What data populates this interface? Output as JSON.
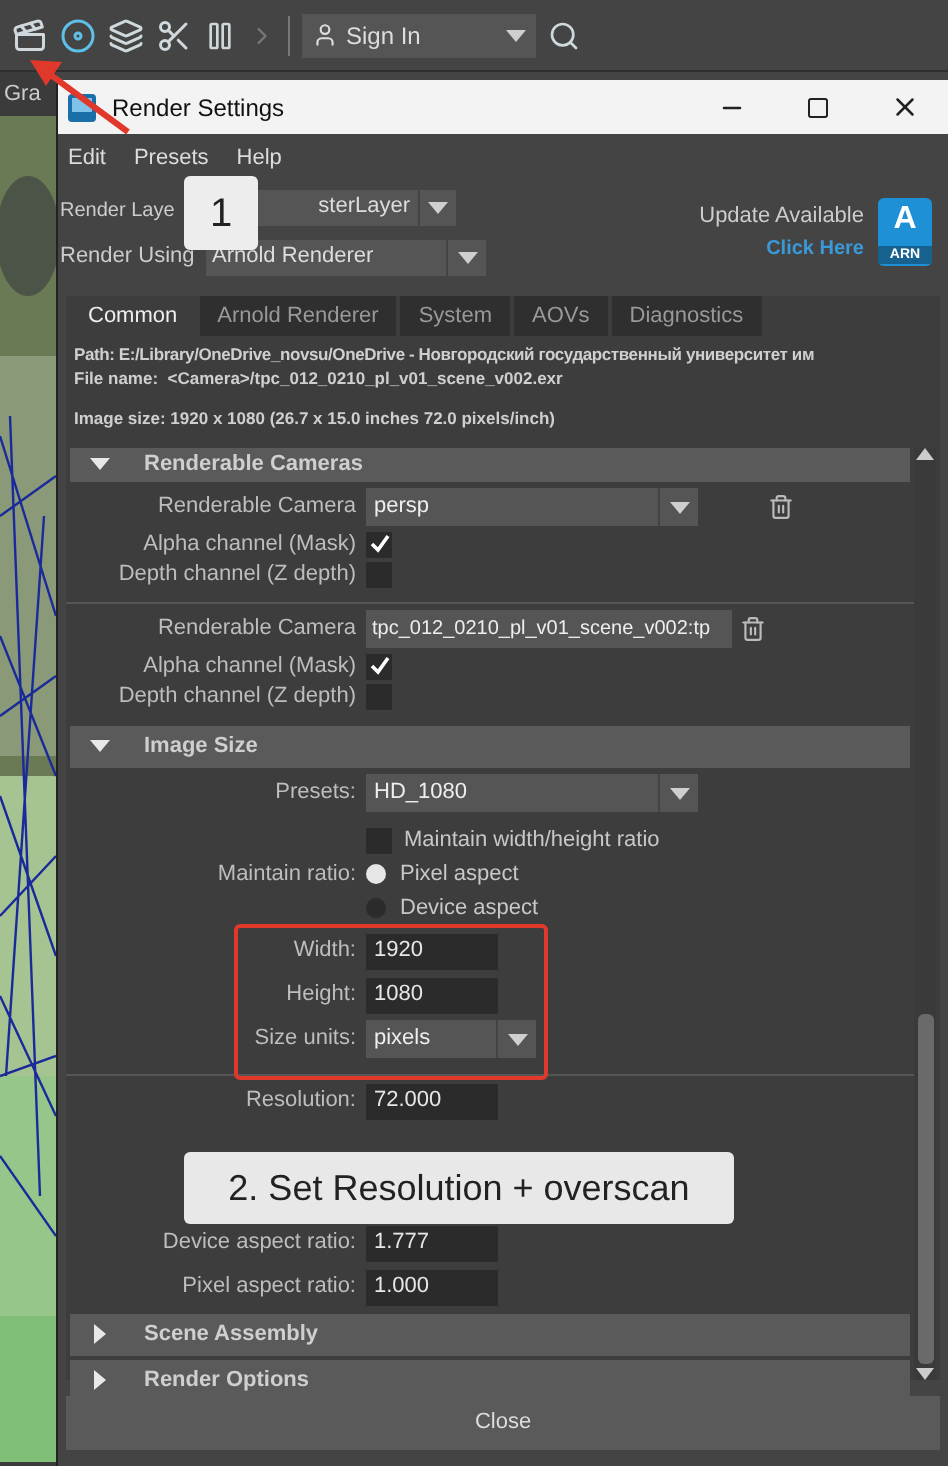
{
  "toolbar": {
    "sign_in": "Sign In"
  },
  "background_tab": "Gra",
  "window": {
    "title": "Render Settings"
  },
  "menu": [
    "Edit",
    "Presets",
    "Help"
  ],
  "render_layer": {
    "label": "Render Laye",
    "value": "sterLayer"
  },
  "render_using": {
    "label": "Render Using",
    "value": "Arnold Renderer"
  },
  "update": {
    "title": "Update Available",
    "link": "Click Here",
    "badge_letter": "A",
    "badge_text": "ARN"
  },
  "tabs": [
    {
      "label": "Common",
      "selected": true
    },
    {
      "label": "Arnold Renderer",
      "selected": false
    },
    {
      "label": "System",
      "selected": false
    },
    {
      "label": "AOVs",
      "selected": false
    },
    {
      "label": "Diagnostics",
      "selected": false
    }
  ],
  "path": "Path: E:/Library/OneDrive_novsu/OneDrive - Новгородский государственный университет им",
  "file_name": {
    "label": "File name:",
    "value": "<Camera>/tpc_012_0210_pl_v01_scene_v002.exr"
  },
  "image_size": "Image size: 1920 x 1080 (26.7 x 15.0 inches 72.0 pixels/inch)",
  "renderable_cameras": {
    "title": "Renderable Cameras",
    "expanded": true,
    "cameras": [
      {
        "label": "Renderable Camera",
        "value": "persp",
        "kind": "dropdown",
        "channels": [
          {
            "label": "Alpha channel (Mask)",
            "checked": true
          },
          {
            "label": "Depth channel (Z depth)",
            "checked": false
          }
        ]
      },
      {
        "label": "Renderable Camera",
        "value": "tpc_012_0210_pl_v01_scene_v002:tp",
        "kind": "text",
        "channels": [
          {
            "label": "Alpha channel (Mask)",
            "checked": true
          },
          {
            "label": "Depth channel (Z depth)",
            "checked": false
          }
        ]
      }
    ]
  },
  "image_size_section": {
    "title": "Image Size",
    "expanded": true,
    "rows_before": [
      {
        "kind": "dropdown",
        "label": "Presets:",
        "value": "HD_1080"
      },
      {
        "kind": "checkbox",
        "label": "Maintain width/height ratio",
        "checked": false
      },
      {
        "kind": "radio",
        "label": "Maintain ratio:",
        "options": [
          {
            "label": "Pixel aspect",
            "selected": true
          },
          {
            "label": "Device aspect",
            "selected": false
          }
        ]
      }
    ],
    "highlighted_rows": [
      {
        "kind": "field",
        "label": "Width:",
        "value": "1920"
      },
      {
        "kind": "field",
        "label": "Height:",
        "value": "1080"
      },
      {
        "kind": "dropdown",
        "label": "Size units:",
        "value": "pixels"
      }
    ],
    "rows_after": [
      {
        "kind": "field",
        "label": "Resolution:",
        "value": "72.000"
      }
    ],
    "rows_under_callout": [
      {
        "kind": "field",
        "label": "Device aspect ratio:",
        "value": "1.777"
      },
      {
        "kind": "field",
        "label": "Pixel aspect ratio:",
        "value": "1.000"
      }
    ]
  },
  "collapsed_sections": [
    {
      "title": "Scene Assembly",
      "expanded": false
    },
    {
      "title": "Render Options",
      "expanded": false
    }
  ],
  "close_button": "Close",
  "callouts": [
    "1",
    "2. Set Resolution + overscan"
  ]
}
